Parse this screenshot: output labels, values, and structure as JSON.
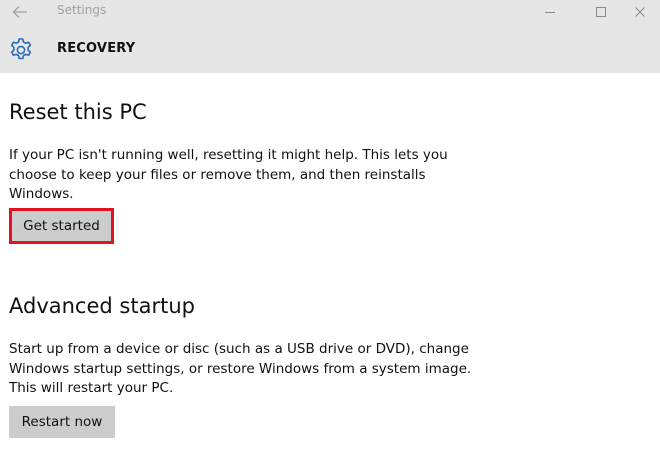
{
  "window": {
    "title": "Settings",
    "back_icon": "arrow-left-icon",
    "controls": [
      "minimize-icon",
      "maximize-icon",
      "close-icon"
    ]
  },
  "header": {
    "icon": "gear-icon",
    "title": "RECOVERY"
  },
  "sections": {
    "reset": {
      "title": "Reset this PC",
      "description": "If your PC isn't running well, resetting it might help. This lets you choose to keep your files or remove them, and then reinstalls Windows.",
      "button_label": "Get started",
      "highlight_color": "#e0141e"
    },
    "advanced": {
      "title": "Advanced startup",
      "description": "Start up from a device or disc (such as a USB drive or DVD), change Windows startup settings, or restore Windows from a system image. This will restart your PC.",
      "button_label": "Restart now"
    }
  },
  "colors": {
    "chrome_bg": "#e6e6e6",
    "button_bg": "#cccccc",
    "text": "#111111"
  }
}
